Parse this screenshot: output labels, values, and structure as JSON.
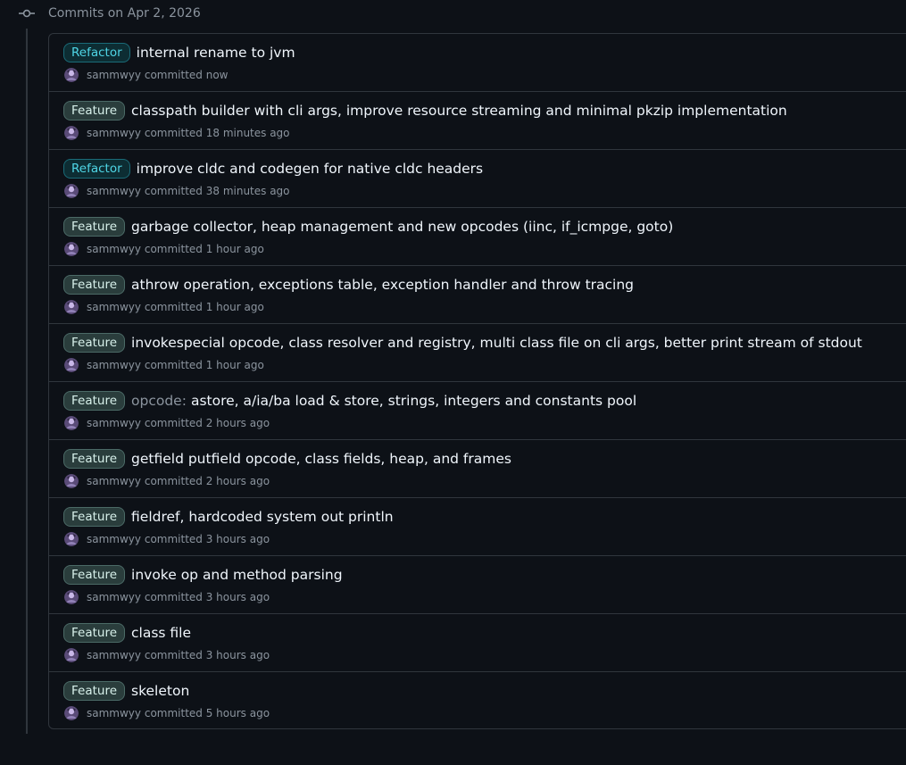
{
  "group": {
    "title": "Commits on Apr 2, 2026"
  },
  "commits": [
    {
      "badge": "Refactor",
      "type": "refactor",
      "scope": "",
      "message": "internal rename to jvm",
      "author": "sammwyy",
      "action": "committed",
      "time": "now"
    },
    {
      "badge": "Feature",
      "type": "feature",
      "scope": "",
      "message": "classpath builder with cli args, improve resource streaming and minimal pkzip implementation",
      "author": "sammwyy",
      "action": "committed",
      "time": "18 minutes ago"
    },
    {
      "badge": "Refactor",
      "type": "refactor",
      "scope": "",
      "message": "improve cldc and codegen for native cldc headers",
      "author": "sammwyy",
      "action": "committed",
      "time": "38 minutes ago"
    },
    {
      "badge": "Feature",
      "type": "feature",
      "scope": "",
      "message": "garbage collector, heap management and new opcodes (iinc, if_icmpge, goto)",
      "author": "sammwyy",
      "action": "committed",
      "time": "1 hour ago"
    },
    {
      "badge": "Feature",
      "type": "feature",
      "scope": "",
      "message": "athrow operation, exceptions table, exception handler and throw tracing",
      "author": "sammwyy",
      "action": "committed",
      "time": "1 hour ago"
    },
    {
      "badge": "Feature",
      "type": "feature",
      "scope": "",
      "message": "invokespecial opcode, class resolver and registry, multi class file on cli args, better print stream of stdout",
      "author": "sammwyy",
      "action": "committed",
      "time": "1 hour ago"
    },
    {
      "badge": "Feature",
      "type": "feature",
      "scope": "opcode:",
      "message": "astore, a/ia/ba load & store, strings, integers and constants pool",
      "author": "sammwyy",
      "action": "committed",
      "time": "2 hours ago"
    },
    {
      "badge": "Feature",
      "type": "feature",
      "scope": "",
      "message": "getfield putfield opcode, class fields, heap, and frames",
      "author": "sammwyy",
      "action": "committed",
      "time": "2 hours ago"
    },
    {
      "badge": "Feature",
      "type": "feature",
      "scope": "",
      "message": "fieldref, hardcoded system out println",
      "author": "sammwyy",
      "action": "committed",
      "time": "3 hours ago"
    },
    {
      "badge": "Feature",
      "type": "feature",
      "scope": "",
      "message": "invoke op and method parsing",
      "author": "sammwyy",
      "action": "committed",
      "time": "3 hours ago"
    },
    {
      "badge": "Feature",
      "type": "feature",
      "scope": "",
      "message": "class file",
      "author": "sammwyy",
      "action": "committed",
      "time": "3 hours ago"
    },
    {
      "badge": "Feature",
      "type": "feature",
      "scope": "",
      "message": "skeleton",
      "author": "sammwyy",
      "action": "committed",
      "time": "5 hours ago"
    }
  ],
  "colors": {
    "background": "#0d1117",
    "border": "#30363d",
    "muted_text": "#8b949e",
    "feature_badge_text": "#d7f0ea",
    "refactor_badge_text": "#4fd6e6"
  },
  "icons": {
    "group_icon": "git-commit-icon",
    "author_avatar": "avatar"
  }
}
